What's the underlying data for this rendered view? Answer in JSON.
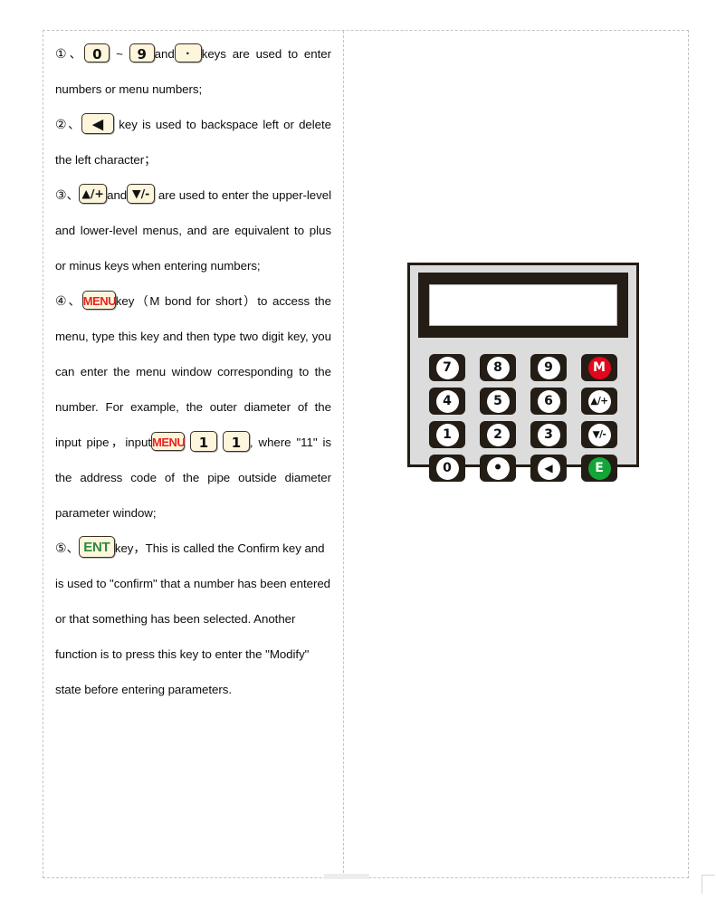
{
  "document": {
    "paragraphs": [
      {
        "id": "item-1",
        "marker": "①",
        "sep": "、",
        "runs": [
          {
            "type": "key",
            "style": "num",
            "label": "0",
            "name": "inline-key-0"
          },
          {
            "type": "text",
            "text": " ~ "
          },
          {
            "type": "key",
            "style": "num",
            "label": "9",
            "name": "inline-key-9"
          },
          {
            "type": "text",
            "text": "and"
          },
          {
            "type": "key",
            "style": "dot",
            "label": "·",
            "name": "inline-key-dot"
          },
          {
            "type": "text",
            "text": "keys are used to enter numbers or menu numbers;"
          }
        ]
      },
      {
        "id": "item-2",
        "marker": "②",
        "sep": "、",
        "runs": [
          {
            "type": "key",
            "style": "arrowleft",
            "label": "◀",
            "name": "inline-key-backspace"
          },
          {
            "type": "text",
            "text": " key is used to backspace left or delete the left character；"
          }
        ]
      },
      {
        "id": "item-3",
        "marker": "③",
        "sep": "、",
        "runs": [
          {
            "type": "key",
            "style": "updown",
            "label": "▲/+",
            "name": "inline-key-up-plus"
          },
          {
            "type": "text",
            "text": "and"
          },
          {
            "type": "key",
            "style": "updown",
            "label": "▼/-",
            "name": "inline-key-down-minus"
          },
          {
            "type": "text",
            "text": " are used to enter the upper-level and lower-level menus, and are equivalent to plus or minus keys when entering numbers;"
          }
        ]
      },
      {
        "id": "item-4",
        "marker": "④",
        "sep": "、",
        "runs": [
          {
            "type": "key",
            "style": "menu",
            "label": "MENU",
            "name": "inline-key-menu"
          },
          {
            "type": "text",
            "text": "key（M bond for short）to access the menu, type this key and then type two digit key, you can enter the menu window corresponding to the number. For example, the outer diameter of the input pipe，input"
          },
          {
            "type": "key",
            "style": "menu",
            "label": "MENU",
            "name": "inline-key-menu-2"
          },
          {
            "type": "text",
            "text": " "
          },
          {
            "type": "key",
            "style": "num wide",
            "label": "1",
            "name": "inline-key-1-a"
          },
          {
            "type": "text",
            "text": " "
          },
          {
            "type": "key",
            "style": "num wide",
            "label": "1",
            "name": "inline-key-1-b"
          },
          {
            "type": "text",
            "text": ", where \"11\" is the address code of the pipe outside diameter parameter window;"
          }
        ]
      },
      {
        "id": "item-5",
        "marker": "⑤",
        "sep": "、",
        "runs": [
          {
            "type": "key",
            "style": "ent",
            "label": "ENT",
            "name": "inline-key-ent"
          },
          {
            "type": "text",
            "text": "key，This is called the Confirm key and is used to \"confirm\" that a number has been entered or that something has been selected. Another function is to press this key to enter the \"Modify\" state before entering parameters."
          }
        ]
      }
    ]
  },
  "device": {
    "name": "keypad-panel",
    "display": {
      "name": "lcd-screen",
      "content": ""
    },
    "keys": [
      {
        "label": "7",
        "name": "keypad-key-7",
        "variant": "plain"
      },
      {
        "label": "8",
        "name": "keypad-key-8",
        "variant": "plain"
      },
      {
        "label": "9",
        "name": "keypad-key-9",
        "variant": "plain"
      },
      {
        "label": "M",
        "name": "keypad-key-menu",
        "variant": "red"
      },
      {
        "label": "4",
        "name": "keypad-key-4",
        "variant": "plain"
      },
      {
        "label": "5",
        "name": "keypad-key-5",
        "variant": "plain"
      },
      {
        "label": "6",
        "name": "keypad-key-6",
        "variant": "plain"
      },
      {
        "label": "▲/+",
        "name": "keypad-key-up-plus",
        "variant": "small"
      },
      {
        "label": "1",
        "name": "keypad-key-1",
        "variant": "plain"
      },
      {
        "label": "2",
        "name": "keypad-key-2",
        "variant": "plain"
      },
      {
        "label": "3",
        "name": "keypad-key-3",
        "variant": "plain"
      },
      {
        "label": "▼/-",
        "name": "keypad-key-down-minus",
        "variant": "small"
      },
      {
        "label": "0",
        "name": "keypad-key-0",
        "variant": "plain"
      },
      {
        "label": "•",
        "name": "keypad-key-dot",
        "variant": "dotcap"
      },
      {
        "label": "◀",
        "name": "keypad-key-backspace",
        "variant": "tri"
      },
      {
        "label": "E",
        "name": "keypad-key-enter",
        "variant": "green"
      }
    ]
  },
  "colors": {
    "key_chip_bg": "#fdf6dd",
    "key_chip_border": "#3a3226",
    "menu_red": "#e8241f",
    "ent_green": "#2d8a3e",
    "device_body": "#dcdcdc",
    "device_frame": "#231d16",
    "key_red": "#e2071c",
    "key_green": "#13a538",
    "table_border": "#c3c3c3"
  }
}
